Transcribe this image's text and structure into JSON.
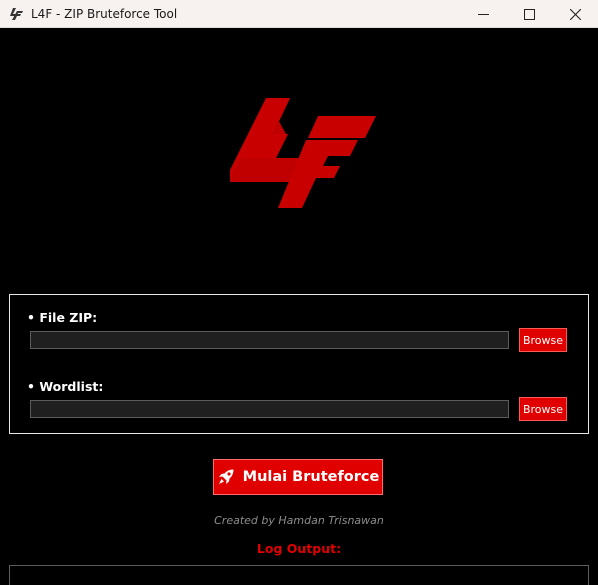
{
  "window": {
    "title": "L4F - ZIP Bruteforce Tool",
    "icons": {
      "app": "l4f-app-icon",
      "minimize": "minimize-icon",
      "maximize": "maximize-icon",
      "close": "close-icon"
    }
  },
  "logo": {
    "text": "L4F",
    "color": "#c80000"
  },
  "form": {
    "zip_label": "• File ZIP:",
    "zip_value": "",
    "wordlist_label": "• Wordlist:",
    "wordlist_value": "",
    "browse_label": "Browse"
  },
  "start_button": {
    "label": "Mulai Bruteforce",
    "icon": "rocket-icon"
  },
  "credit": "Created by Hamdan Trisnawan",
  "log": {
    "label": "Log Output:",
    "content": ""
  },
  "colors": {
    "accent": "#e00000",
    "background": "#000000",
    "text": "#ffffff",
    "muted": "#8c8c8c"
  }
}
